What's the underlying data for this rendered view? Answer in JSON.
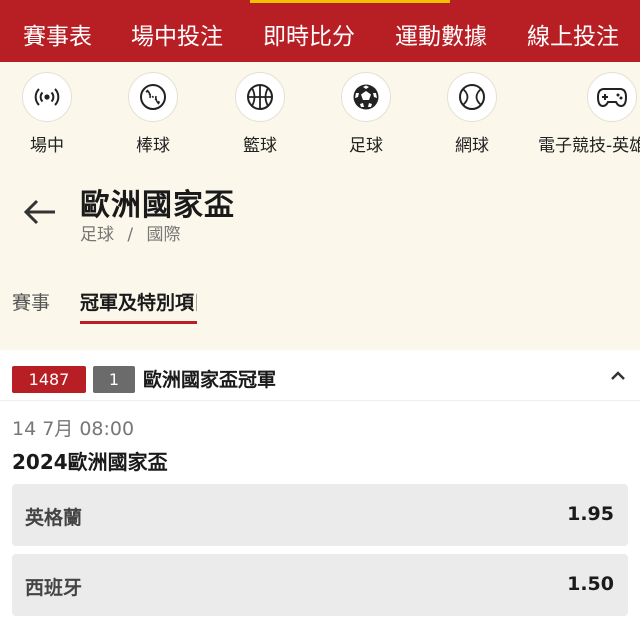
{
  "topnav": {
    "items": [
      "賽事表",
      "場中投注",
      "即時比分",
      "運動數據",
      "線上投注"
    ]
  },
  "sports": [
    {
      "label": "場中",
      "icon": "live-signal-icon"
    },
    {
      "label": "棒球",
      "icon": "baseball-icon"
    },
    {
      "label": "籃球",
      "icon": "basketball-icon"
    },
    {
      "label": "足球",
      "icon": "soccer-ball-icon"
    },
    {
      "label": "網球",
      "icon": "tennis-ball-icon"
    },
    {
      "label": "電子競技-英雄",
      "icon": "gamepad-icon"
    }
  ],
  "header": {
    "title": "歐洲國家盃",
    "breadcrumb": [
      "足球",
      "/",
      "國際"
    ]
  },
  "tabs": {
    "events": "賽事",
    "champion": "冠軍及特別項目"
  },
  "market": {
    "count": "1487",
    "index": "1",
    "title": "歐洲國家盃冠軍",
    "date": "14 7月  08:00",
    "event": "2024歐洲國家盃",
    "selections": [
      {
        "team": "英格蘭",
        "price": "1.95"
      },
      {
        "team": "西班牙",
        "price": "1.50"
      }
    ]
  },
  "colors": {
    "brand_red": "#b81f24",
    "accent_gold": "#f2c200",
    "background": "#fbf7ea"
  }
}
